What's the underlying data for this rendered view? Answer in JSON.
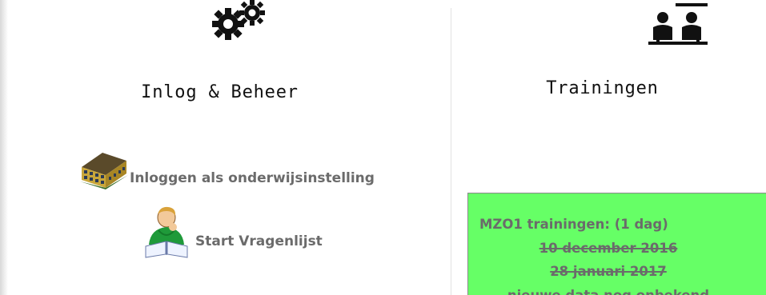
{
  "left_column": {
    "icon": "gears-icon",
    "title": "Inlog & Beheer",
    "links": [
      {
        "icon": "school-building-icon",
        "label": "Inloggen als onderwijsinstelling"
      },
      {
        "icon": "student-reading-icon",
        "label": "Start Vragenlijst"
      }
    ]
  },
  "right_column": {
    "icon": "training-people-icon",
    "title": "Trainingen",
    "announcement": {
      "background": "#66ff66",
      "heading": "MZO1 trainingen: (1 dag)",
      "dates": [
        "10 december 2016",
        "28 januari 2017 "
      ],
      "note": "nieuwe data nog onbekend"
    }
  }
}
